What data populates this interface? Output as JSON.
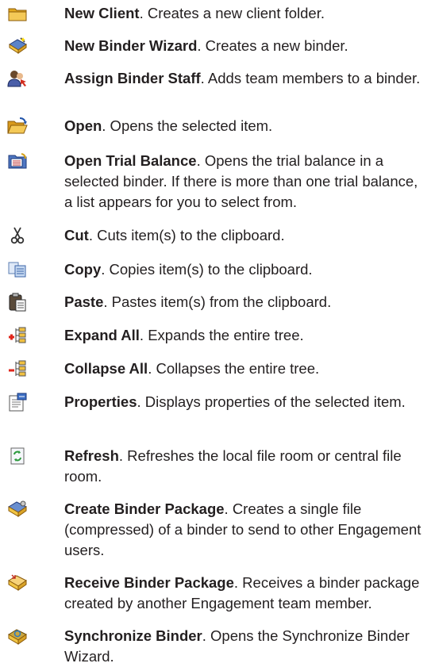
{
  "items": [
    {
      "icon": "folder-icon",
      "name": "New Client",
      "desc": ". Creates a new client folder."
    },
    {
      "icon": "binder-wizard-icon",
      "name": "New Binder Wizard",
      "desc": ". Creates a new binder."
    },
    {
      "icon": "assign-staff-icon",
      "name": "Assign Binder Staff",
      "desc": ". Adds team members to a binder."
    },
    {
      "icon": "open-folder-icon",
      "name": "Open",
      "desc": ". Opens the selected item."
    },
    {
      "icon": "trial-balance-icon",
      "name": "Open Trial Balance",
      "desc": ". Opens the trial balance in a selected binder. If there is more than one trial balance, a list appears for you to select from."
    },
    {
      "icon": "scissors-icon",
      "name": "Cut",
      "desc": ". Cuts item(s) to the clipboard."
    },
    {
      "icon": "copy-icon",
      "name": "Copy",
      "desc": ". Copies item(s) to the clipboard."
    },
    {
      "icon": "paste-icon",
      "name": "Paste",
      "desc": ". Pastes item(s) from the clipboard."
    },
    {
      "icon": "expand-tree-icon",
      "name": "Expand All",
      "desc": ". Expands the entire tree."
    },
    {
      "icon": "collapse-tree-icon",
      "name": "Collapse All",
      "desc": ". Collapses the entire tree."
    },
    {
      "icon": "properties-icon",
      "name": "Properties",
      "desc": ". Displays properties of the selected item."
    },
    {
      "icon": "refresh-icon",
      "name": "Refresh",
      "desc": ". Refreshes the local file room or central file room."
    },
    {
      "icon": "create-package-icon",
      "name": "Create Binder Package",
      "desc": ". Creates a single file (compressed) of a binder to send to other Engagement users."
    },
    {
      "icon": "receive-package-icon",
      "name": "Receive Binder Package",
      "desc": ". Receives a binder package created by another Engagement team member."
    },
    {
      "icon": "synchronize-icon",
      "name": "Synchronize Binder",
      "desc": ". Opens the Synchronize Binder Wizard."
    }
  ]
}
